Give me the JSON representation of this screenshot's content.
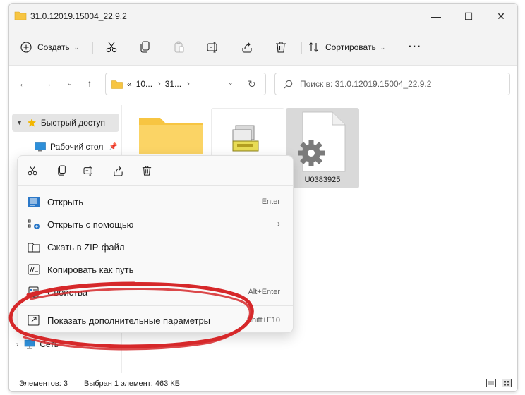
{
  "window": {
    "title": "31.0.12019.15004_22.9.2",
    "controls": {
      "minimize": "—",
      "maximize": "☐",
      "close": "✕"
    }
  },
  "commandbar": {
    "create_label": "Создать",
    "sort_label": "Сортировать",
    "more_label": "···"
  },
  "nav": {
    "breadcrumb": [
      "10...",
      "31..."
    ],
    "breadcrumb_prefix": "«",
    "search_placeholder": "Поиск в: 31.0.12019.15004_22.9.2"
  },
  "sidebar": {
    "quick_access": "Быстрый доступ",
    "desktop": "Рабочий стол",
    "network": "Сеть"
  },
  "files": [
    {
      "name": "",
      "type": "folder"
    },
    {
      "name": "",
      "type": "installer"
    },
    {
      "name": "U0383925",
      "type": "settings-file",
      "selected": true
    }
  ],
  "context_menu": {
    "items": [
      {
        "label": "Открыть",
        "shortcut": "Enter"
      },
      {
        "label": "Открыть с помощью",
        "shortcut": ""
      },
      {
        "label": "Сжать в ZIP-файл",
        "shortcut": ""
      },
      {
        "label": "Копировать как путь",
        "shortcut": ""
      },
      {
        "label": "Свойства",
        "shortcut": "Alt+Enter"
      },
      {
        "label": "Показать дополнительные параметры",
        "shortcut": "Shift+F10"
      }
    ]
  },
  "status": {
    "items_count": "Элементов: 3",
    "selection": "Выбран 1 элемент: 463 КБ"
  },
  "colors": {
    "accent": "#0067c0",
    "annotation": "#d6282a",
    "folder": "#f7c542"
  }
}
